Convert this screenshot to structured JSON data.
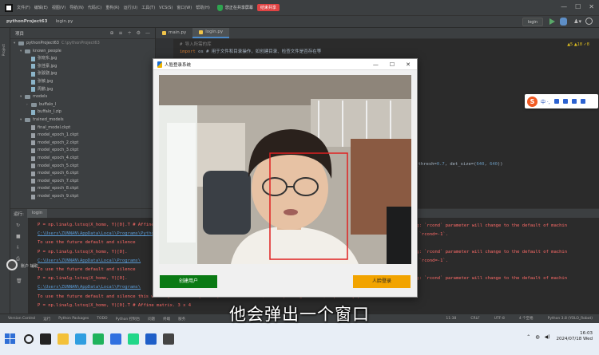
{
  "menubar": {
    "items": [
      "文件(F)",
      "编辑(E)",
      "视图(V)",
      "导航(N)",
      "代码(C)",
      "重构(R)",
      "运行(U)",
      "工具(T)",
      "VCS(S)",
      "窗口(W)",
      "帮助(H)"
    ],
    "meeting_share": "您正在共享屏幕",
    "meeting_end": "结束共享",
    "min": "—",
    "max": "☐",
    "close": "✕"
  },
  "navbar": {
    "project": "pythonProject63",
    "file": "login.py",
    "run_config": "login",
    "account": "♟▾"
  },
  "project_panel": {
    "header": "项目",
    "tools": [
      "⊕",
      "≡",
      "÷",
      "⚙",
      "—"
    ],
    "items": [
      {
        "label": "pythonProject63",
        "hint": "C:\\pythonProject63",
        "type": "folder",
        "depth": 0,
        "arrow": "▾"
      },
      {
        "label": "known_people",
        "hint": "",
        "type": "folder",
        "depth": 1,
        "arrow": "▾"
      },
      {
        "label": "张晓东.jpg",
        "hint": "",
        "type": "file",
        "depth": 2,
        "arrow": ""
      },
      {
        "label": "张佳豪.jpg",
        "hint": "",
        "type": "file",
        "depth": 2,
        "arrow": ""
      },
      {
        "label": "张骏骁.jpg",
        "hint": "",
        "type": "file",
        "depth": 2,
        "arrow": ""
      },
      {
        "label": "张敏.jpg",
        "hint": "",
        "type": "file",
        "depth": 2,
        "arrow": ""
      },
      {
        "label": "周鹏.jpg",
        "hint": "",
        "type": "file",
        "depth": 2,
        "arrow": ""
      },
      {
        "label": "models",
        "hint": "",
        "type": "folder",
        "depth": 1,
        "arrow": "▾"
      },
      {
        "label": "buffalo_l",
        "hint": "",
        "type": "folder",
        "depth": 2,
        "arrow": "›"
      },
      {
        "label": "buffalo_l.zip",
        "hint": "",
        "type": "file",
        "depth": 2,
        "arrow": ""
      },
      {
        "label": "trained_models",
        "hint": "",
        "type": "folder",
        "depth": 1,
        "arrow": "▾"
      },
      {
        "label": "final_model.ckpt",
        "hint": "",
        "type": "ckpt",
        "depth": 2,
        "arrow": ""
      },
      {
        "label": "model_epoch_1.ckpt",
        "hint": "",
        "type": "ckpt",
        "depth": 2,
        "arrow": ""
      },
      {
        "label": "model_epoch_2.ckpt",
        "hint": "",
        "type": "ckpt",
        "depth": 2,
        "arrow": ""
      },
      {
        "label": "model_epoch_3.ckpt",
        "hint": "",
        "type": "ckpt",
        "depth": 2,
        "arrow": ""
      },
      {
        "label": "model_epoch_4.ckpt",
        "hint": "",
        "type": "ckpt",
        "depth": 2,
        "arrow": ""
      },
      {
        "label": "model_epoch_5.ckpt",
        "hint": "",
        "type": "ckpt",
        "depth": 2,
        "arrow": ""
      },
      {
        "label": "model_epoch_6.ckpt",
        "hint": "",
        "type": "ckpt",
        "depth": 2,
        "arrow": ""
      },
      {
        "label": "model_epoch_7.ckpt",
        "hint": "",
        "type": "ckpt",
        "depth": 2,
        "arrow": ""
      },
      {
        "label": "model_epoch_8.ckpt",
        "hint": "",
        "type": "ckpt",
        "depth": 2,
        "arrow": ""
      },
      {
        "label": "model_epoch_9.ckpt",
        "hint": "",
        "type": "ckpt",
        "depth": 2,
        "arrow": ""
      }
    ]
  },
  "editor": {
    "tabs": [
      "main.py",
      "login.py"
    ],
    "code_line1_comment": "# 导入所需的库",
    "code_line2_kw": "import",
    "code_line2_rest": " os  # 用于文件和目录操作，如创建目录、检查文件是否存在等",
    "code_line3_prefix": "t_thresh=",
    "code_line3_val1": "0.7",
    "code_line3_mid": ", det_size=(",
    "code_line3_val2": "640",
    "code_line3_sep": ", ",
    "code_line3_val3": "640",
    "code_line3_end": "))",
    "warnings": "▲5 ▲18 ✓8"
  },
  "run_panel": {
    "label": "运行:",
    "tab": "login",
    "lines": [
      {
        "text": "  P = np.linalg.lstsq(X_homo, Y)[0].T # Affine matrix. 3 x 4",
        "style": "err"
      },
      {
        "text": "C:\\Users\\ZUNNAN\\AppData\\Local\\Programs\\Python\\",
        "style": "link"
      },
      {
        "text": "To use the future default and silence",
        "style": "err"
      },
      {
        "text": "  P = np.linalg.lstsq(X_homo, Y)[0].",
        "style": "err"
      },
      {
        "text": "C:\\Users\\ZUNNAN\\AppData\\Local\\Programs\\",
        "style": "link"
      },
      {
        "text": "To use the future default and silence",
        "style": "err"
      },
      {
        "text": "  P = np.linalg.lstsq(X_homo, Y)[0].",
        "style": "err"
      },
      {
        "text": "C:\\Users\\ZUNNAN\\AppData\\Local\\Programs\\",
        "style": "link"
      },
      {
        "text": "To use the future default and silence this warning we advise you to pass `rcond=None`, to keep using the old, explicitly pass `rcond=-1`.",
        "style": "err"
      },
      {
        "text": "  P = np.linalg.lstsq(X_homo, Y)[0].T # Affine matrix. 3 x 4",
        "style": "err"
      }
    ],
    "right_lines": [
      "ng: `rcond` parameter will change to the default of machin",
      "s `rcond=-1`.",
      "ng: `rcond` parameter will change to the default of machin",
      "s `rcond=-1`.",
      "ng: `rcond` parameter will change to the default of machin"
    ]
  },
  "tool_tabs": [
    "Version Control",
    "运行",
    "Python Packages",
    "TODO",
    "Python 控制台",
    "问题",
    "终端",
    "服务"
  ],
  "statusbar": {
    "position": "11:38",
    "line_sep": "CRLF",
    "encoding": "UTF-8",
    "indent": "4 个空格",
    "interpreter": "Python 3.8 (YOLO_Robot)"
  },
  "taskbar": {
    "time": "16:03",
    "date": "2024/07/18 Wed"
  },
  "dialog": {
    "title": "人脸登录系统",
    "create_button": "创建用户",
    "login_button": "人脸登录",
    "min": "—",
    "max": "☐",
    "close": "✕"
  },
  "ime": {
    "logo": "S",
    "mode": "中 ·,"
  },
  "subtitle": "他会弹出一个窗口",
  "float_label": "账户 辅助"
}
